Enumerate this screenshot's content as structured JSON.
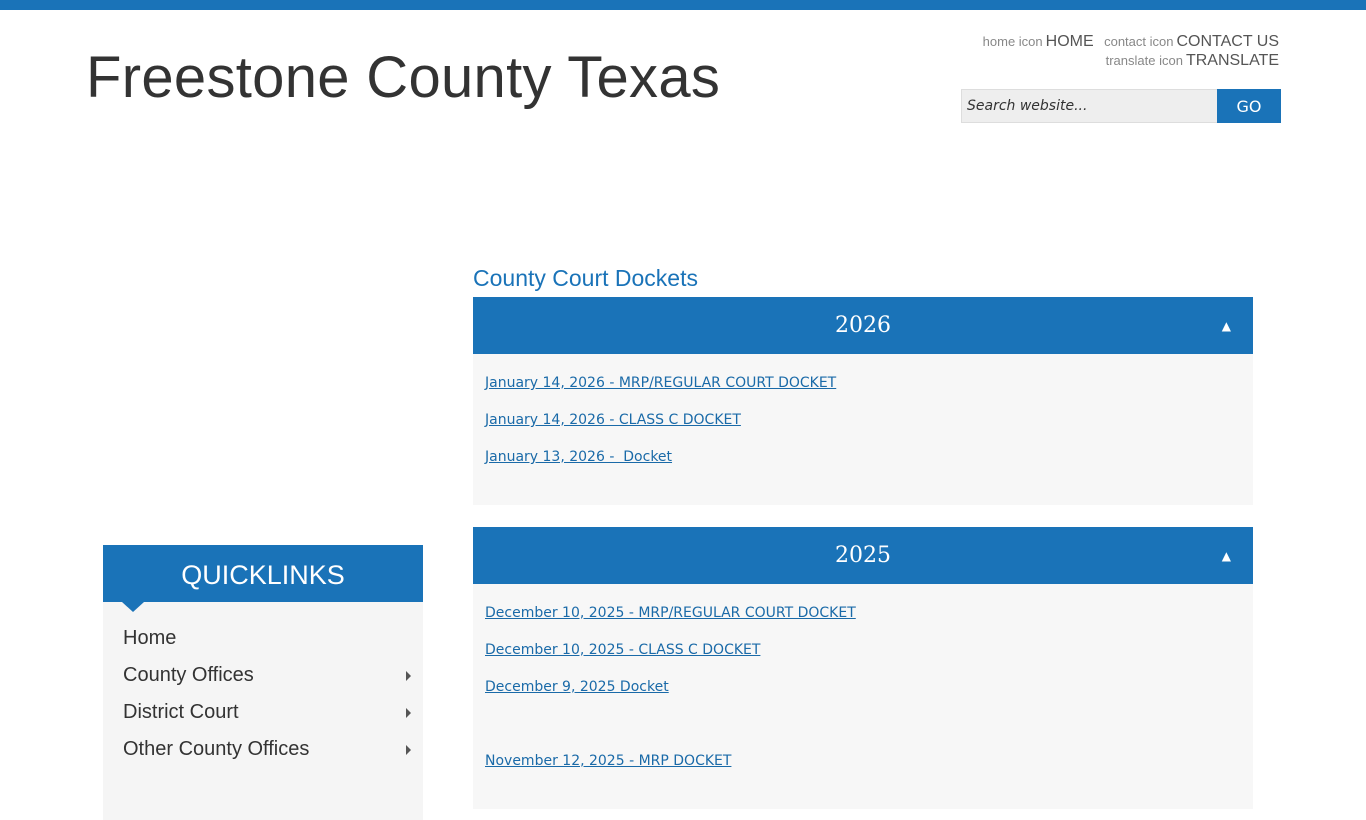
{
  "site": {
    "title": "Freestone County Texas"
  },
  "utility": {
    "home_icon_alt": "home icon",
    "home": "HOME",
    "contact_icon_alt": "contact icon",
    "contact": "CONTACT US",
    "translate_icon_alt": "translate icon",
    "translate": "TRANSLATE"
  },
  "search": {
    "placeholder": "Search website...",
    "button": "GO"
  },
  "quicklinks": {
    "title": "QUICKLINKS",
    "items": [
      {
        "label": "Home",
        "has_sub": false
      },
      {
        "label": "County Offices",
        "has_sub": true
      },
      {
        "label": "District Court",
        "has_sub": true
      },
      {
        "label": "Other County Offices",
        "has_sub": true
      }
    ]
  },
  "main": {
    "title": "County Court Dockets",
    "sections": [
      {
        "year": "2026",
        "toggle": "▲",
        "links": [
          "January 14, 2026 - MRP/REGULAR COURT DOCKET",
          "January 14, 2026 - CLASS C DOCKET",
          "January 13, 2026 -  Docket"
        ]
      },
      {
        "year": "2025",
        "toggle": "▲",
        "links": [
          "December 10, 2025 - MRP/REGULAR COURT DOCKET",
          "December 10, 2025 - CLASS C DOCKET",
          "December 9, 2025 Docket",
          "",
          "November 12, 2025 - MRP DOCKET"
        ]
      }
    ]
  },
  "colors": {
    "brand_blue": "#1a73b8",
    "link_blue": "#1a6aa8",
    "panel_bg": "#f7f7f7"
  }
}
